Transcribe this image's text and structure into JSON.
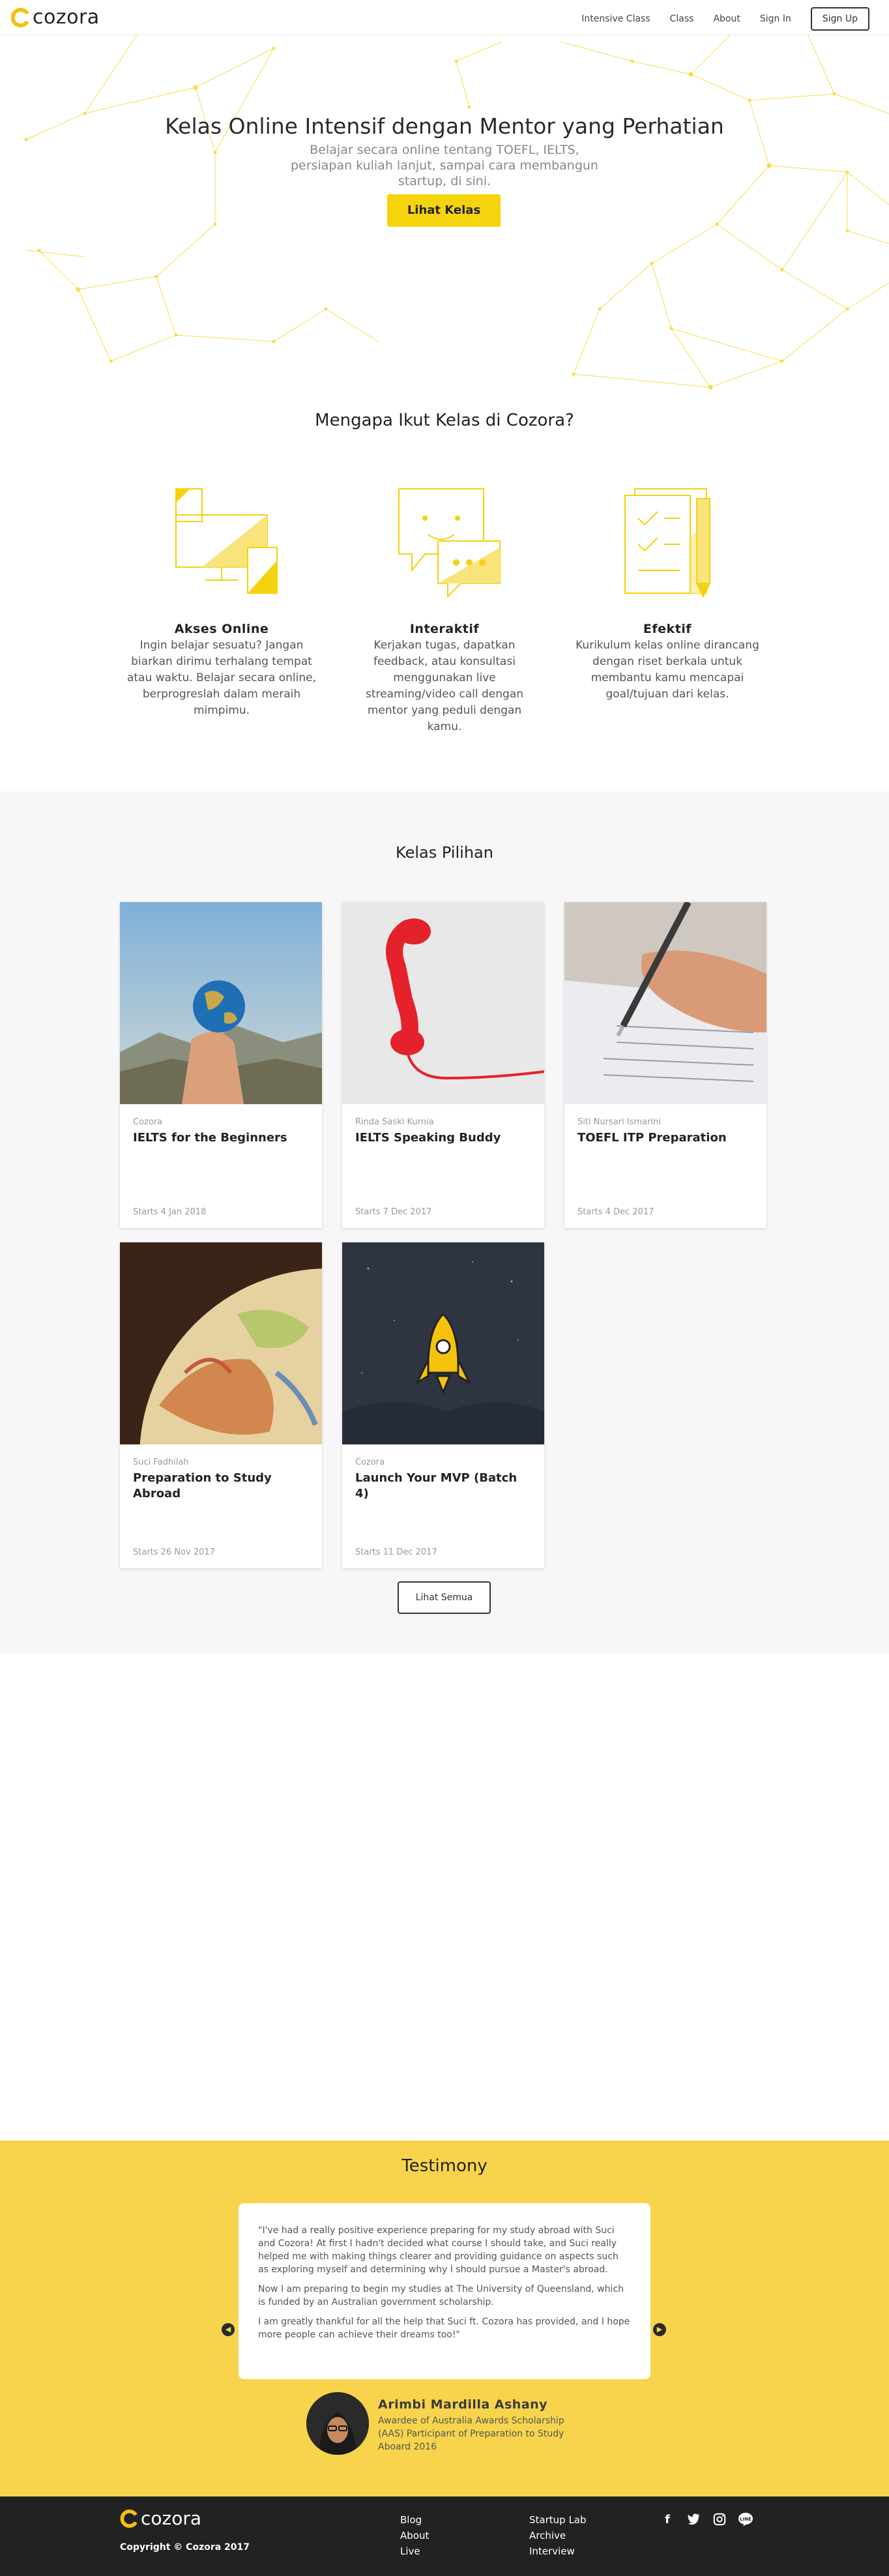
{
  "brand": {
    "name": "cozora",
    "accent": "#f5d40e"
  },
  "nav": {
    "links": [
      "Intensive Class",
      "Class",
      "About",
      "Sign In"
    ],
    "signup": "Sign Up"
  },
  "hero": {
    "title": "Kelas Online Intensif dengan Mentor yang Perhatian",
    "subtitle": "Belajar secara online tentang TOEFL, IELTS, persiapan kuliah lanjut, sampai cara membangun startup, di sini.",
    "cta": "Lihat Kelas"
  },
  "why": {
    "title": "Mengapa Ikut Kelas di Cozora?",
    "features": [
      {
        "icon": "devices-icon",
        "name": "Akses Online",
        "desc": "Ingin belajar sesuatu? Jangan biarkan dirimu terhalang tempat atau waktu. Belajar secara online, berprogreslah dalam meraih mimpimu."
      },
      {
        "icon": "chat-icon",
        "name": "Interaktif",
        "desc": "Kerjakan tugas, dapatkan feedback, atau konsultasi menggunakan live streaming/video call dengan mentor yang peduli dengan kamu."
      },
      {
        "icon": "checklist-icon",
        "name": "Efektif",
        "desc": "Kurikulum kelas online dirancang dengan riset berkala untuk membantu kamu mencapai goal/tujuan dari kelas."
      }
    ]
  },
  "classes": {
    "title": "Kelas Pilihan",
    "items": [
      {
        "author": "Cozora",
        "title": "IELTS for the Beginners",
        "date": "Starts 4 Jan 2018",
        "image": "globe-in-hand"
      },
      {
        "author": "Rinda Saski Kurnia",
        "title": "IELTS Speaking Buddy",
        "date": "Starts 7 Dec 2017",
        "image": "red-telephone"
      },
      {
        "author": "Siti Nursari Ismarini",
        "title": "TOEFL ITP Preparation",
        "date": "Starts 4 Dec 2017",
        "image": "writing-test"
      },
      {
        "author": "Suci Fadhilah",
        "title": "Preparation to Study Abroad",
        "date": "Starts 26 Nov 2017",
        "image": "world-globe"
      },
      {
        "author": "Cozora",
        "title": "Launch Your MVP (Batch 4)",
        "date": "Starts 11 Dec 2017",
        "image": "rocket"
      }
    ],
    "see_all": "Lihat Semua"
  },
  "testimony": {
    "title": "Testimony",
    "quote": [
      "\"I've had a really positive experience preparing for my study abroad with Suci and Cozora! At first I hadn't decided what course I should take, and Suci really helped me with making things clearer and providing guidance on aspects such as exploring myself and determining why I should pursue a Master's abroad.",
      "Now I am preparing to begin my studies at The University of Queensland, which is funded by an Australian government scholarship.",
      "I am greatly thankful for all the help that Suci ft. Cozora has provided, and I hope more people can achieve their dreams too!\""
    ],
    "name": "Arimbi Mardilla Ashany",
    "role": "Awardee of Australia Awards Scholarship (AAS) Participant of Preparation to Study Aboard 2016"
  },
  "footer": {
    "logo": "cozora",
    "copyright": "Copyright © Cozora 2017",
    "col1": [
      "Blog",
      "About",
      "Live"
    ],
    "col2": [
      "Startup Lab",
      "Archive",
      "Interview"
    ],
    "socials": [
      "facebook-icon",
      "twitter-icon",
      "instagram-icon",
      "line-icon"
    ]
  }
}
